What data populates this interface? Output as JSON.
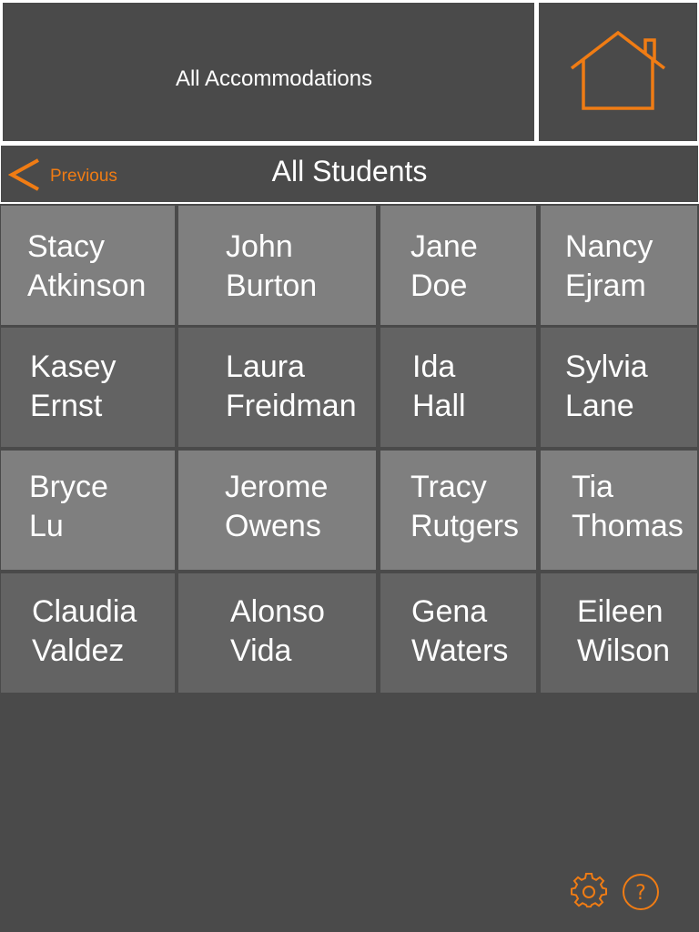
{
  "header": {
    "title": "All Accommodations",
    "home_icon": "home-icon"
  },
  "nav": {
    "previous_label": "Previous",
    "back_icon": "chevron-left-icon",
    "title": "All Students"
  },
  "students": [
    {
      "first": "Stacy",
      "last": "Atkinson"
    },
    {
      "first": "John",
      "last": "Burton"
    },
    {
      "first": "Jane",
      "last": "Doe"
    },
    {
      "first": "Nancy",
      "last": "Ejram"
    },
    {
      "first": "Kasey",
      "last": "Ernst"
    },
    {
      "first": "Laura",
      "last": "Freidman"
    },
    {
      "first": "Ida",
      "last": "Hall"
    },
    {
      "first": "Sylvia",
      "last": "Lane"
    },
    {
      "first": "Bryce",
      "last": "Lu"
    },
    {
      "first": "Jerome",
      "last": "Owens"
    },
    {
      "first": "Tracy",
      "last": "Rutgers"
    },
    {
      "first": "Tia",
      "last": "Thomas"
    },
    {
      "first": "Claudia",
      "last": "Valdez"
    },
    {
      "first": "Alonso",
      "last": "Vida"
    },
    {
      "first": "Gena",
      "last": "Waters"
    },
    {
      "first": "Eileen",
      "last": "Wilson"
    }
  ],
  "footer": {
    "settings_icon": "gear-icon",
    "help_icon": "help-icon"
  },
  "colors": {
    "accent": "#f07c14",
    "panel": "#4a4a4a",
    "cell_light": "#7f7f7f",
    "cell_dark": "#636363",
    "text": "#ffffff"
  }
}
